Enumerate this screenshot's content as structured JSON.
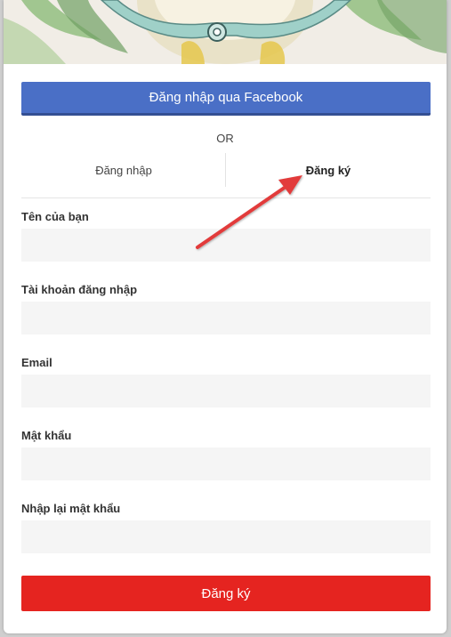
{
  "facebook_login": {
    "label": "Đăng nhập qua Facebook"
  },
  "divider_text": "OR",
  "tabs": [
    {
      "label": "Đăng nhập",
      "active": false
    },
    {
      "label": "Đăng ký",
      "active": true
    }
  ],
  "form": {
    "fields": [
      {
        "label": "Tên của bạn",
        "value": ""
      },
      {
        "label": "Tài khoản đăng nhập",
        "value": ""
      },
      {
        "label": "Email",
        "value": ""
      },
      {
        "label": "Mật khẩu",
        "value": ""
      },
      {
        "label": "Nhập lại mật khẩu",
        "value": ""
      }
    ],
    "submit_label": "Đăng ký"
  },
  "colors": {
    "facebook_button": "#4a6fc6",
    "submit_button": "#e52420",
    "annotation_arrow": "#e23b3b"
  },
  "icons": {
    "banner": "illustration-owl",
    "annotation": "arrow-icon"
  }
}
